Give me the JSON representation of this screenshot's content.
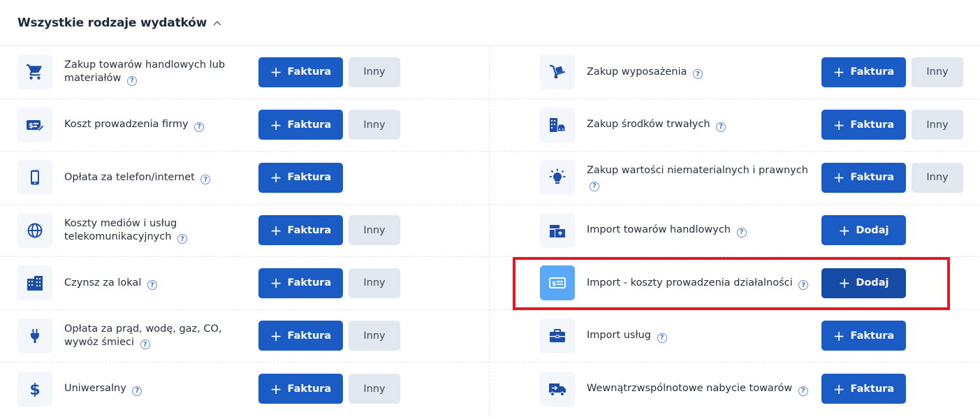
{
  "header": {
    "title": "Wszystkie rodzaje wydatków"
  },
  "colors": {
    "primary": "#1a5bc4",
    "secondary": "#e2e8f0",
    "highlight": "#e01b24",
    "icon": "#1d4fa8"
  },
  "left_items": [
    {
      "label": "Zakup towarów handlowych lub materiałów",
      "icon": "cart-icon",
      "primary_label": "Faktura",
      "secondary_label": "Inny"
    },
    {
      "label": "Koszt prowadzenia firmy",
      "icon": "money-edit-icon",
      "primary_label": "Faktura",
      "secondary_label": "Inny"
    },
    {
      "label": "Opłata za telefon/internet",
      "icon": "phone-icon",
      "primary_label": "Faktura"
    },
    {
      "label": "Koszty mediów i usług telekomunikacyjnych",
      "icon": "globe-icon",
      "primary_label": "Faktura",
      "secondary_label": "Inny"
    },
    {
      "label": "Czynsz za lokal",
      "icon": "building-icon",
      "primary_label": "Faktura",
      "secondary_label": "Inny"
    },
    {
      "label": "Opłata za prąd, wodę, gaz, CO, wywóz śmieci",
      "icon": "plug-icon",
      "primary_label": "Faktura",
      "secondary_label": "Inny"
    },
    {
      "label": "Uniwersalny",
      "icon": "dollar-icon",
      "primary_label": "Faktura",
      "secondary_label": "Inny"
    }
  ],
  "right_items": [
    {
      "label": "Zakup wyposażenia",
      "icon": "hand-truck-icon",
      "primary_label": "Faktura",
      "secondary_label": "Inny"
    },
    {
      "label": "Zakup środków trwałych",
      "icon": "building-car-icon",
      "primary_label": "Faktura",
      "secondary_label": "Inny"
    },
    {
      "label": "Zakup wartości niematerialnych i prawnych",
      "icon": "lightbulb-icon",
      "primary_label": "Faktura",
      "secondary_label": "Inny"
    },
    {
      "label": "Import towarów handlowych",
      "icon": "import-boxes-icon",
      "primary_label": "Dodaj"
    },
    {
      "label": "Import - koszty prowadzenia działalności",
      "icon": "money-card-icon",
      "primary_label": "Dodaj",
      "active": true
    },
    {
      "label": "Import usług",
      "icon": "briefcase-icon",
      "primary_label": "Faktura"
    },
    {
      "label": "Wewnątrzwspólnotowe nabycie towarów",
      "icon": "truck-icon",
      "primary_label": "Faktura"
    }
  ]
}
